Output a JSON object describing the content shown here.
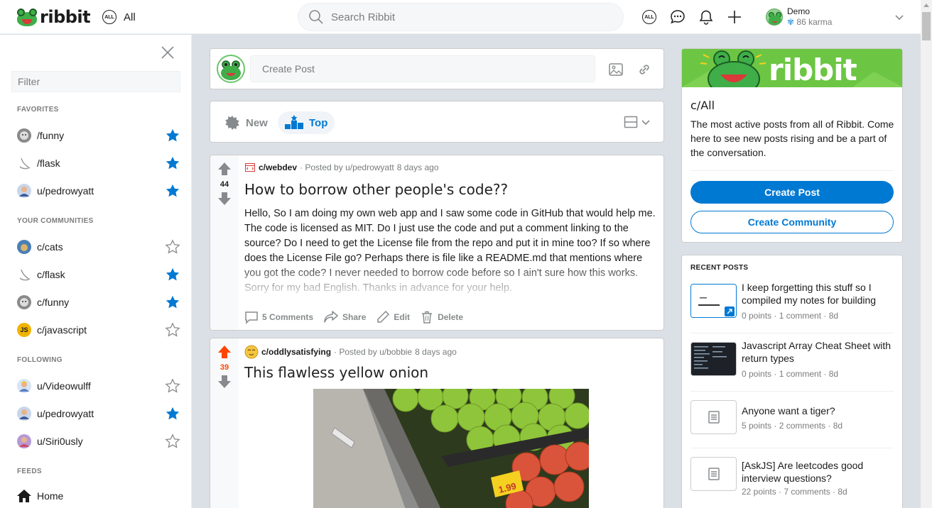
{
  "app": {
    "name": "ribbit",
    "feed_label": "All",
    "all_badge": "ALL"
  },
  "search": {
    "placeholder": "Search Ribbit"
  },
  "user": {
    "name": "Demo",
    "karma": "86 karma"
  },
  "sidebar": {
    "filter_placeholder": "Filter",
    "favorites_heading": "FAVORITES",
    "favorites": [
      {
        "label": "/funny",
        "starred": true
      },
      {
        "label": "/flask",
        "starred": true
      },
      {
        "label": "u/pedrowyatt",
        "starred": true
      }
    ],
    "communities_heading": "YOUR COMMUNITIES",
    "communities": [
      {
        "label": "c/cats",
        "starred": false
      },
      {
        "label": "c/flask",
        "starred": true
      },
      {
        "label": "c/funny",
        "starred": true
      },
      {
        "label": "c/javascript",
        "starred": false,
        "avatar_text": "JS"
      }
    ],
    "following_heading": "FOLLOWING",
    "following": [
      {
        "label": "u/Videowulff",
        "starred": false
      },
      {
        "label": "u/pedrowyatt",
        "starred": true
      },
      {
        "label": "u/Siri0usly",
        "starred": false
      }
    ],
    "feeds_heading": "FEEDS",
    "feeds": [
      {
        "label": "Home"
      }
    ]
  },
  "create_post": {
    "placeholder": "Create Post"
  },
  "sort": {
    "new_label": "New",
    "top_label": "Top",
    "active": "Top"
  },
  "posts": [
    {
      "community": "c/webdev",
      "posted_by": "· Posted by u/pedrowyatt",
      "age": "8 days ago",
      "votes": "44",
      "title": "How to borrow other people's code??",
      "body": "Hello, So I am doing my own web app and I saw some code in GitHub that would help me. The code is licensed as MIT. Do I just use the code and put a comment linking to the source? Do I need to get the License file from the repo and put it in mine too? If so where does the License File go? Perhaps there is file like a README.md that mentions where you got the code? I never needed to borrow code before so I ain't sure how this works. Sorry for my bad English. Thanks in advance for your help.",
      "comments": "5 Comments",
      "share": "Share",
      "edit": "Edit",
      "delete": "Delete"
    },
    {
      "community": "c/oddlysatisfying",
      "posted_by": "· Posted by u/bobbie",
      "age": "8 days ago",
      "votes": "39",
      "upvoted": true,
      "title": "This flawless yellow onion",
      "price_tag": "1.99"
    }
  ],
  "about": {
    "banner_text": "ribbit",
    "title": "c/All",
    "description": "The most active posts from all of Ribbit. Come here to see new posts rising and be a part of the conversation.",
    "create_post_label": "Create Post",
    "create_community_label": "Create Community"
  },
  "recent_posts": {
    "heading": "RECENT POSTS",
    "items": [
      {
        "title": "I keep forgetting this stuff so I compiled my notes for building",
        "meta": "0 points · 1 comment · 8d"
      },
      {
        "title": "Javascript Array Cheat Sheet with return types",
        "meta": "0 points · 1 comment · 8d"
      },
      {
        "title": "Anyone want a tiger?",
        "meta": "5 points · 2 comments · 8d"
      },
      {
        "title": "[AskJS] Are leetcodes good interview questions?",
        "meta": "22 points · 7 comments · 8d"
      }
    ]
  },
  "colors": {
    "accent": "#0079d3",
    "upvote": "#ff4500",
    "brand_green": "#6cc644"
  }
}
